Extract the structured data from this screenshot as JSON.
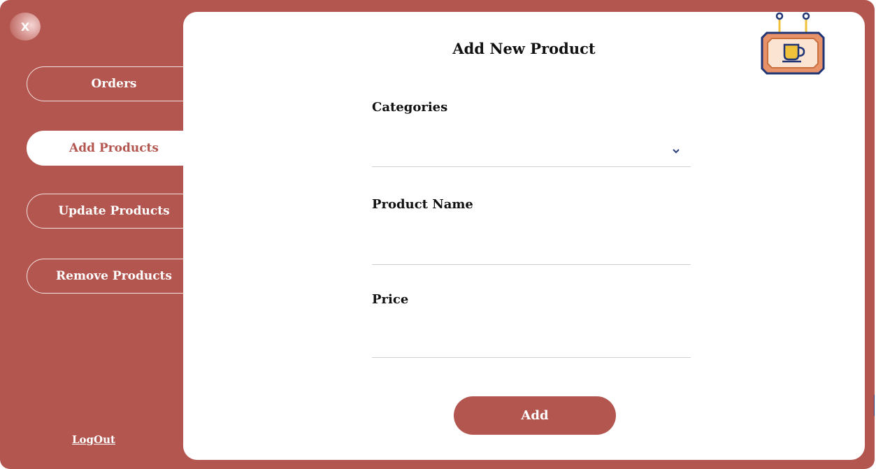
{
  "window": {
    "close_label": "X"
  },
  "sidebar": {
    "items": [
      {
        "label": "Orders"
      },
      {
        "label": "Add Products",
        "active": true
      },
      {
        "label": "Update Products"
      },
      {
        "label": "Remove Products"
      }
    ],
    "logout_label": "LogOut"
  },
  "main": {
    "title": "Add New Product",
    "fields": {
      "categories": {
        "label": "Categories",
        "value": ""
      },
      "product_name": {
        "label": "Product Name",
        "value": ""
      },
      "price": {
        "label": "Price",
        "value": ""
      }
    },
    "add_label": "Add",
    "logo_icon": "coffee-shop-sign-icon"
  },
  "colors": {
    "accent": "#b3564f",
    "background": "#ffffff",
    "text": "#111111"
  }
}
